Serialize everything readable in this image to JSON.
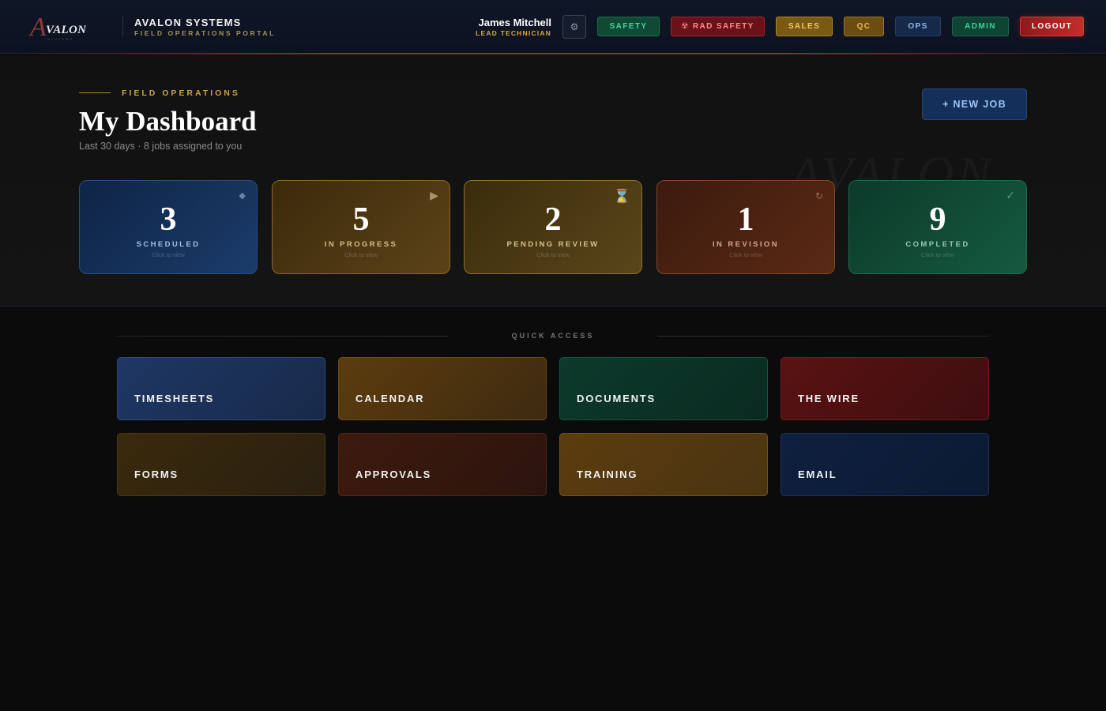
{
  "header": {
    "logo_letter": "A",
    "logo_word": "VALON",
    "logo_sub": "SYSTEMS",
    "brand_title": "AVALON SYSTEMS",
    "brand_subtitle": "FIELD OPERATIONS PORTAL",
    "user_name": "James Mitchell",
    "user_role": "LEAD TECHNICIAN",
    "settings_icon": "gear-icon",
    "nav": {
      "safety": "SAFETY",
      "rad_safety": "☢ RAD SAFETY",
      "sales": "SALES",
      "qc": "QC",
      "ops": "OPS",
      "admin": "ADMIN",
      "logout": "LOGOUT"
    }
  },
  "hero": {
    "eyebrow": "FIELD OPERATIONS",
    "title": "My Dashboard",
    "subtitle": "Last 30 days · 8 jobs assigned to you",
    "new_job_label": "+ NEW JOB",
    "watermark": "AVALON",
    "stats": [
      {
        "count": "3",
        "label": "SCHEDULED",
        "hint": "Click to view",
        "icon": "diamond-icon"
      },
      {
        "count": "5",
        "label": "IN PROGRESS",
        "hint": "Click to view",
        "icon": "play-icon"
      },
      {
        "count": "2",
        "label": "PENDING REVIEW",
        "hint": "Click to view",
        "icon": "hourglass-icon"
      },
      {
        "count": "1",
        "label": "IN REVISION",
        "hint": "Click to view",
        "icon": "refresh-icon"
      },
      {
        "count": "9",
        "label": "COMPLETED",
        "hint": "Click to view",
        "icon": "check-icon"
      }
    ]
  },
  "quick_access": {
    "title": "QUICK ACCESS",
    "tiles": [
      "TIMESHEETS",
      "CALENDAR",
      "DOCUMENTS",
      "THE WIRE",
      "FORMS",
      "APPROVALS",
      "TRAINING",
      "EMAIL"
    ]
  },
  "colors": {
    "accent_gold": "#c9a04a",
    "accent_red": "#c42d2a",
    "accent_blue": "#14305a",
    "accent_green": "#0f4a35"
  }
}
